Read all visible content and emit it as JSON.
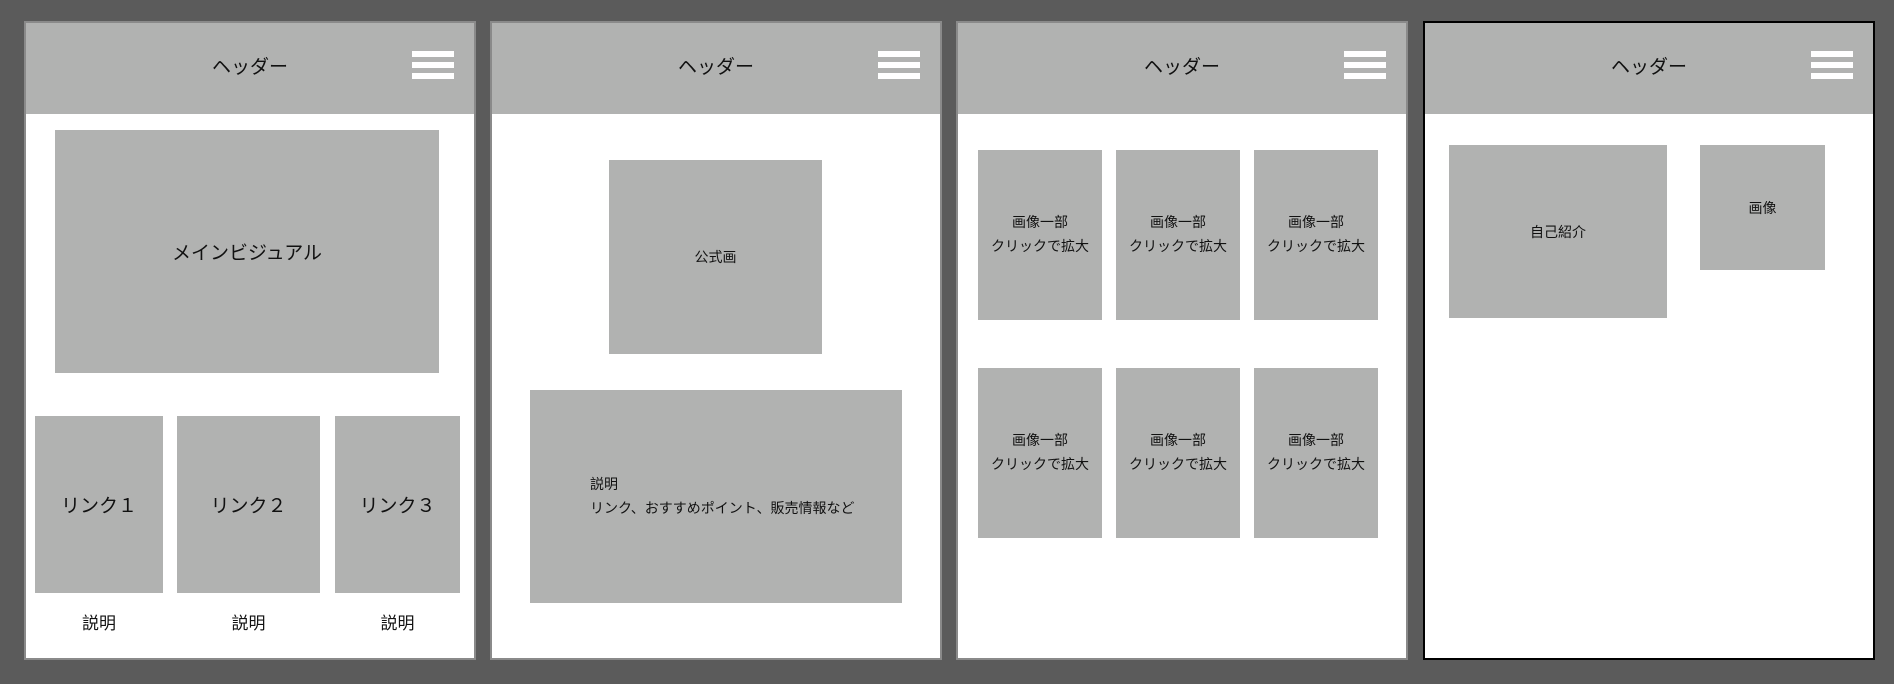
{
  "colors": {
    "background": "#5b5b5b",
    "panel": "#ffffff",
    "block": "#b1b2b1",
    "active_border": "#000000"
  },
  "frames": [
    {
      "header": "ヘッダー",
      "main_visual": "メインビジュアル",
      "links": [
        {
          "label": "リンク１",
          "caption": "説明"
        },
        {
          "label": "リンク２",
          "caption": "説明"
        },
        {
          "label": "リンク３",
          "caption": "説明"
        }
      ]
    },
    {
      "header": "ヘッダー",
      "official_image": "公式画",
      "description": {
        "line1": "説明",
        "line2": "リンク、おすすめポイント、販売情報など"
      }
    },
    {
      "header": "ヘッダー",
      "gallery": [
        {
          "line1": "画像一部",
          "line2": "クリックで拡大"
        },
        {
          "line1": "画像一部",
          "line2": "クリックで拡大"
        },
        {
          "line1": "画像一部",
          "line2": "クリックで拡大"
        },
        {
          "line1": "画像一部",
          "line2": "クリックで拡大"
        },
        {
          "line1": "画像一部",
          "line2": "クリックで拡大"
        },
        {
          "line1": "画像一部",
          "line2": "クリックで拡大"
        }
      ]
    },
    {
      "header": "ヘッダー",
      "profile": "自己紹介",
      "image": "画像"
    }
  ]
}
